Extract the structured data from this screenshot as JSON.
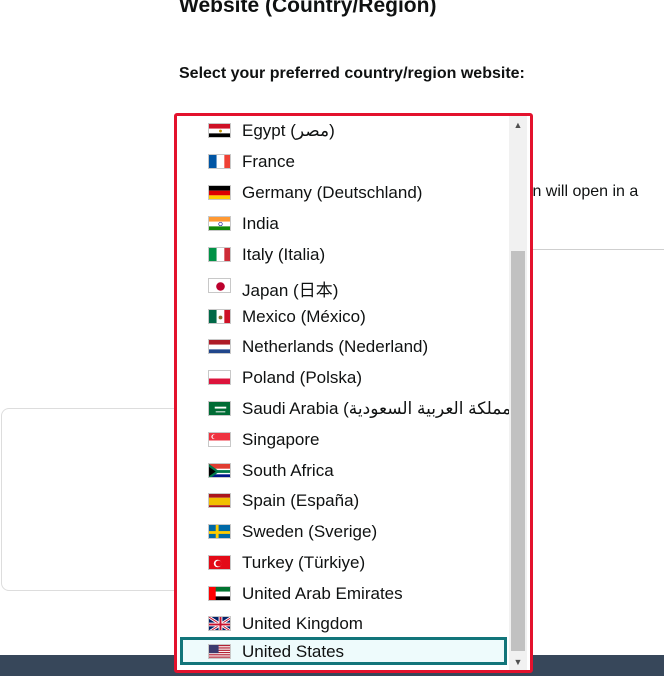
{
  "page": {
    "title": "Website (Country/Region)",
    "select_label": "Select your preferred country/region website:",
    "background_note": "ion will open in a"
  },
  "dropdown": {
    "scroll_up": "▲",
    "scroll_down": "▼",
    "selected": "United States",
    "options": [
      {
        "label": "Egypt (مصر)",
        "flag": "eg"
      },
      {
        "label": "France",
        "flag": "fr"
      },
      {
        "label": "Germany (Deutschland)",
        "flag": "de"
      },
      {
        "label": "India",
        "flag": "in"
      },
      {
        "label": "Italy (Italia)",
        "flag": "it"
      },
      {
        "label": "Japan (日本)",
        "flag": "jp"
      },
      {
        "label": "Mexico (México)",
        "flag": "mx"
      },
      {
        "label": "Netherlands (Nederland)",
        "flag": "nl"
      },
      {
        "label": "Poland (Polska)",
        "flag": "pl"
      },
      {
        "label": "Saudi Arabia (المملكة العربية السعودية)",
        "flag": "sa"
      },
      {
        "label": "Singapore",
        "flag": "sg"
      },
      {
        "label": "South Africa",
        "flag": "za"
      },
      {
        "label": "Spain (España)",
        "flag": "es"
      },
      {
        "label": "Sweden (Sverige)",
        "flag": "se"
      },
      {
        "label": "Turkey (Türkiye)",
        "flag": "tr"
      },
      {
        "label": "United Arab Emirates",
        "flag": "ae"
      },
      {
        "label": "United Kingdom",
        "flag": "gb"
      },
      {
        "label": "United States",
        "flag": "us"
      }
    ]
  }
}
